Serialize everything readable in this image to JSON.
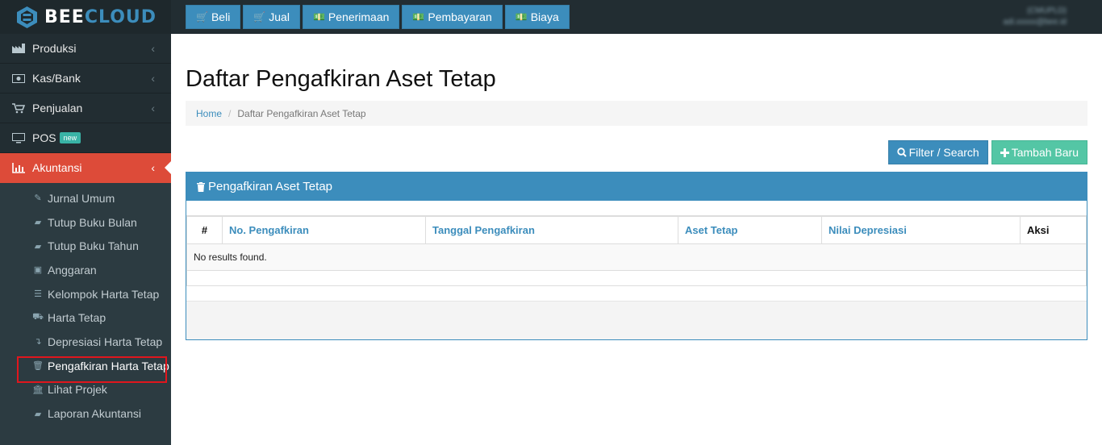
{
  "brand": {
    "name_part1": "BEE",
    "name_part2": "CLOUD"
  },
  "topnav": [
    {
      "label": "Beli",
      "icon": "cart-icon"
    },
    {
      "label": "Jual",
      "icon": "cart-icon"
    },
    {
      "label": "Penerimaan",
      "icon": "money-icon"
    },
    {
      "label": "Pembayaran",
      "icon": "money-icon"
    },
    {
      "label": "Biaya",
      "icon": "money-icon"
    }
  ],
  "user": {
    "name": "(CMUPLD)",
    "email": "adi.xxxxx@bee.id"
  },
  "sidebar": {
    "items": [
      {
        "label": "Produksi",
        "icon": "industry-icon"
      },
      {
        "label": "Kas/Bank",
        "icon": "money-icon"
      },
      {
        "label": "Penjualan",
        "icon": "cart-icon"
      },
      {
        "label": "POS",
        "icon": "desktop-icon",
        "badge": "new"
      },
      {
        "label": "Akuntansi",
        "icon": "bar-chart-icon"
      }
    ],
    "submenu": [
      {
        "label": "Jurnal Umum",
        "icon": "edit-icon"
      },
      {
        "label": "Tutup Buku Bulan",
        "icon": "book-icon"
      },
      {
        "label": "Tutup Buku Tahun",
        "icon": "book-icon"
      },
      {
        "label": "Anggaran",
        "icon": "money-icon"
      },
      {
        "label": "Kelompok Harta Tetap",
        "icon": "list-icon"
      },
      {
        "label": "Harta Tetap",
        "icon": "car-icon"
      },
      {
        "label": "Depresiasi Harta Tetap",
        "icon": "arrow-down-icon"
      },
      {
        "label": "Pengafkiran Harta Tetap",
        "icon": "trash-icon"
      },
      {
        "label": "Lihat Projek",
        "icon": "bank-icon"
      },
      {
        "label": "Laporan Akuntansi",
        "icon": "book-icon"
      }
    ]
  },
  "page": {
    "title": "Daftar Pengafkiran Aset Tetap",
    "breadcrumb": {
      "home": "Home",
      "current": "Daftar Pengafkiran Aset Tetap"
    },
    "buttons": {
      "filter": "Filter / Search",
      "add": "Tambah Baru"
    },
    "panel_title": "Pengafkiran Aset Tetap",
    "table": {
      "columns": [
        "#",
        "No. Pengafkiran",
        "Tanggal Pengafkiran",
        "Aset Tetap",
        "Nilai Depresiasi",
        "Aksi"
      ],
      "empty": "No results found."
    }
  },
  "colors": {
    "primary": "#3c8dbc",
    "danger": "#dd4b39",
    "success": "#54c6a5",
    "sidebar": "#222d32"
  }
}
